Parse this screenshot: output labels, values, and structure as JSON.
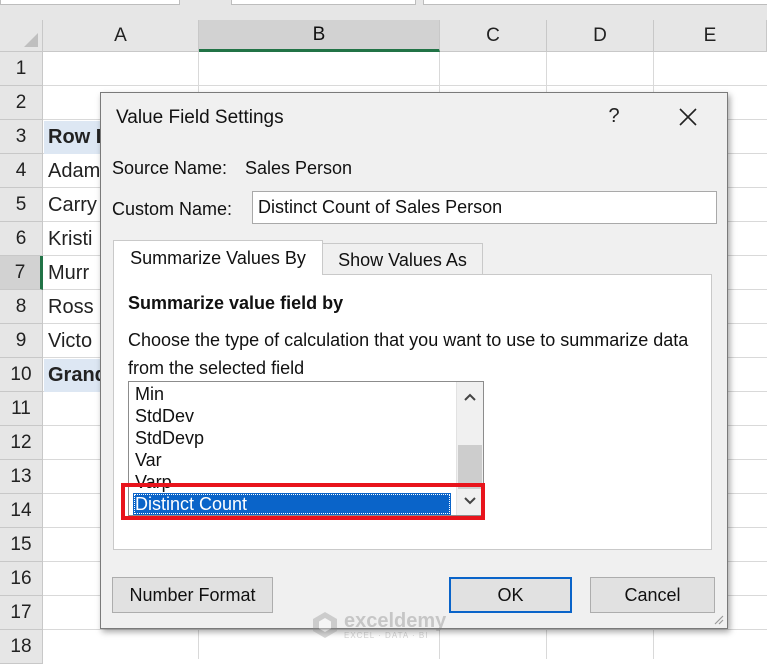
{
  "spreadsheet": {
    "columns": [
      "A",
      "B",
      "C",
      "D",
      "E"
    ],
    "selected_column": "B",
    "rows": [
      "1",
      "2",
      "3",
      "4",
      "5",
      "6",
      "7",
      "8",
      "9",
      "10",
      "11",
      "12",
      "13",
      "14",
      "15",
      "16",
      "17",
      "18"
    ],
    "selected_row": "7",
    "cells_a": {
      "r3": "Row L",
      "r4": "Adam",
      "r5": "Carry",
      "r6": "Kristi",
      "r7": "Murr",
      "r8": "Ross",
      "r9": "Victo",
      "r10": "Grand"
    },
    "header_fill": "#dde7f3",
    "selection_color": "#217346"
  },
  "dialog": {
    "title": "Value Field Settings",
    "help": "?",
    "source_name_label": "Source Name:",
    "source_name_value": "Sales Person",
    "custom_name_label": "Custom Name:",
    "custom_name_value": "Distinct Count of Sales Person",
    "tabs": [
      {
        "label": "Summarize Values By",
        "active": true
      },
      {
        "label": "Show Values As",
        "active": false
      }
    ],
    "section_title": "Summarize value field by",
    "description": "Choose the type of calculation that you want to use to summarize data from the selected field",
    "list_items": [
      "Min",
      "StdDev",
      "StdDevp",
      "Var",
      "Varp"
    ],
    "selected_item": "Distinct Count",
    "buttons": {
      "number_format": "Number Format",
      "ok": "OK",
      "cancel": "Cancel"
    },
    "selection_color": "#0a64c9",
    "highlight_color": "#e8141c"
  },
  "watermark": {
    "name": "exceldemy",
    "tagline": "EXCEL · DATA · BI"
  }
}
